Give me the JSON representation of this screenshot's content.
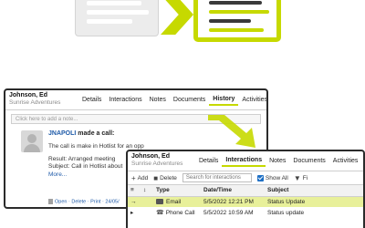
{
  "colors": {
    "accent": "#c6d900",
    "link": "#1e5aa8",
    "highlight_row": "#e8f09a"
  },
  "history_panel": {
    "contact_name": "Johnson, Ed",
    "company": "Sunrise Adventures",
    "tabs": [
      "Details",
      "Interactions",
      "Notes",
      "Documents",
      "History",
      "Activities"
    ],
    "active_tab": "History",
    "note_placeholder": "Click here to add a note...",
    "entry": {
      "user": "JNAPOLI",
      "action": "made a call:",
      "body": "The call is make in Hotlist for an opp",
      "result": "Result: Arranged meeting",
      "subject": "Subject: Call in Hotlist about",
      "more": "More...",
      "footer": "Open · Delete · Print · 24/05/"
    }
  },
  "interactions_panel": {
    "contact_name": "Johnson, Ed",
    "company": "Sunrise Adventures",
    "tabs": [
      "Details",
      "Interactions",
      "Notes",
      "Documents",
      "Activities"
    ],
    "active_tab": "Interactions",
    "toolbar": {
      "add_label": "Add",
      "delete_label": "Delete",
      "search_placeholder": "Search for interactions",
      "show_all_label": "Show All",
      "filter_label": "Fi"
    },
    "columns": [
      "Type",
      "Date/Time",
      "Subject"
    ],
    "rows": [
      {
        "type": "Email",
        "datetime": "5/5/2022 12:21 PM",
        "subject": "Status Update",
        "icon": "envelope-icon"
      },
      {
        "type": "Phone Call",
        "datetime": "5/5/2022 10:59 AM",
        "subject": "Status update",
        "icon": "phone-icon"
      }
    ]
  }
}
